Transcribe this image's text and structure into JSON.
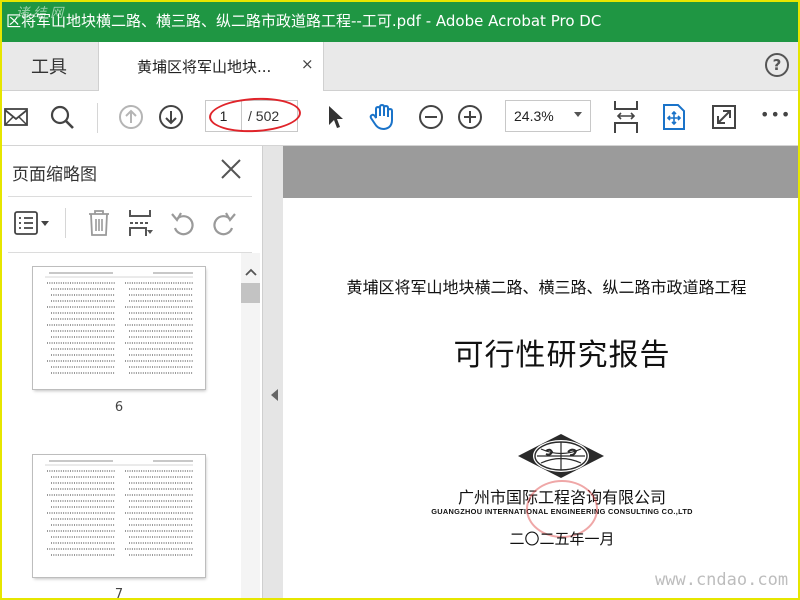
{
  "window": {
    "title": "区将军山地块横二路、横三路、纵二路市政道路工程--工可.pdf - Adobe Acrobat Pro DC",
    "watermark_top": "诸 结 网"
  },
  "tabs": {
    "tools_label": "工具",
    "doc_tab_label": "黄埔区将军山地块...",
    "doc_tab_close": "×",
    "help": "?"
  },
  "toolbar": {
    "page_current": "1",
    "page_total": "/ 502",
    "zoom": "24.3%",
    "more": "•••"
  },
  "panel": {
    "title": "页面缩略图",
    "thumbnails": [
      {
        "page": "6"
      },
      {
        "page": "7"
      }
    ]
  },
  "document": {
    "line1": "黄埔区将军山地块横二路、横三路、纵二路市政道路工程",
    "title": "可行性研究报告",
    "company": "广州市国际工程咨询有限公司",
    "company_en": "GUANGZHOU INTERNATIONAL ENGINEERING CONSULTING CO.,LTD",
    "date": "二〇二五年一月"
  },
  "watermark_bottom": "www.cndao.com",
  "colors": {
    "titlebar": "#1f9643",
    "annotation_ellipse": "#e0242a",
    "frame": "#e6e600",
    "accent_blue": "#1a73c9"
  }
}
